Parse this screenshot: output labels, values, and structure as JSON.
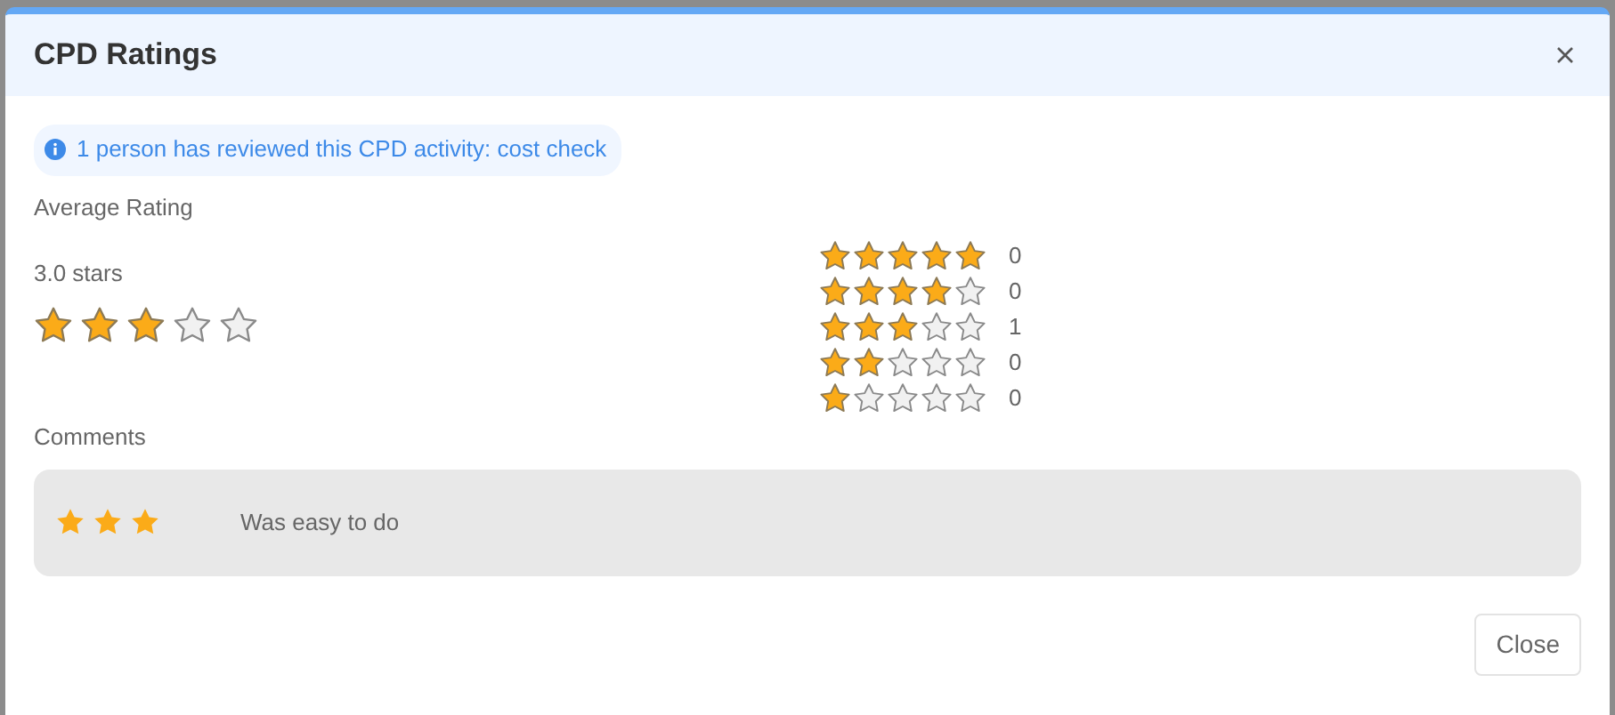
{
  "dialog": {
    "title": "CPD Ratings"
  },
  "notice": "1 person has reviewed this CPD activity: cost check",
  "average": {
    "label": "Average Rating",
    "reading": "3.0 stars",
    "stars": 3
  },
  "breakdown": [
    {
      "stars": 5,
      "count": "0"
    },
    {
      "stars": 4,
      "count": "0"
    },
    {
      "stars": 3,
      "count": "1"
    },
    {
      "stars": 2,
      "count": "0"
    },
    {
      "stars": 1,
      "count": "0"
    }
  ],
  "comments": {
    "label": "Comments",
    "items": [
      {
        "stars": 3,
        "text": "Was easy to do"
      }
    ]
  },
  "buttons": [
    "Close"
  ]
}
